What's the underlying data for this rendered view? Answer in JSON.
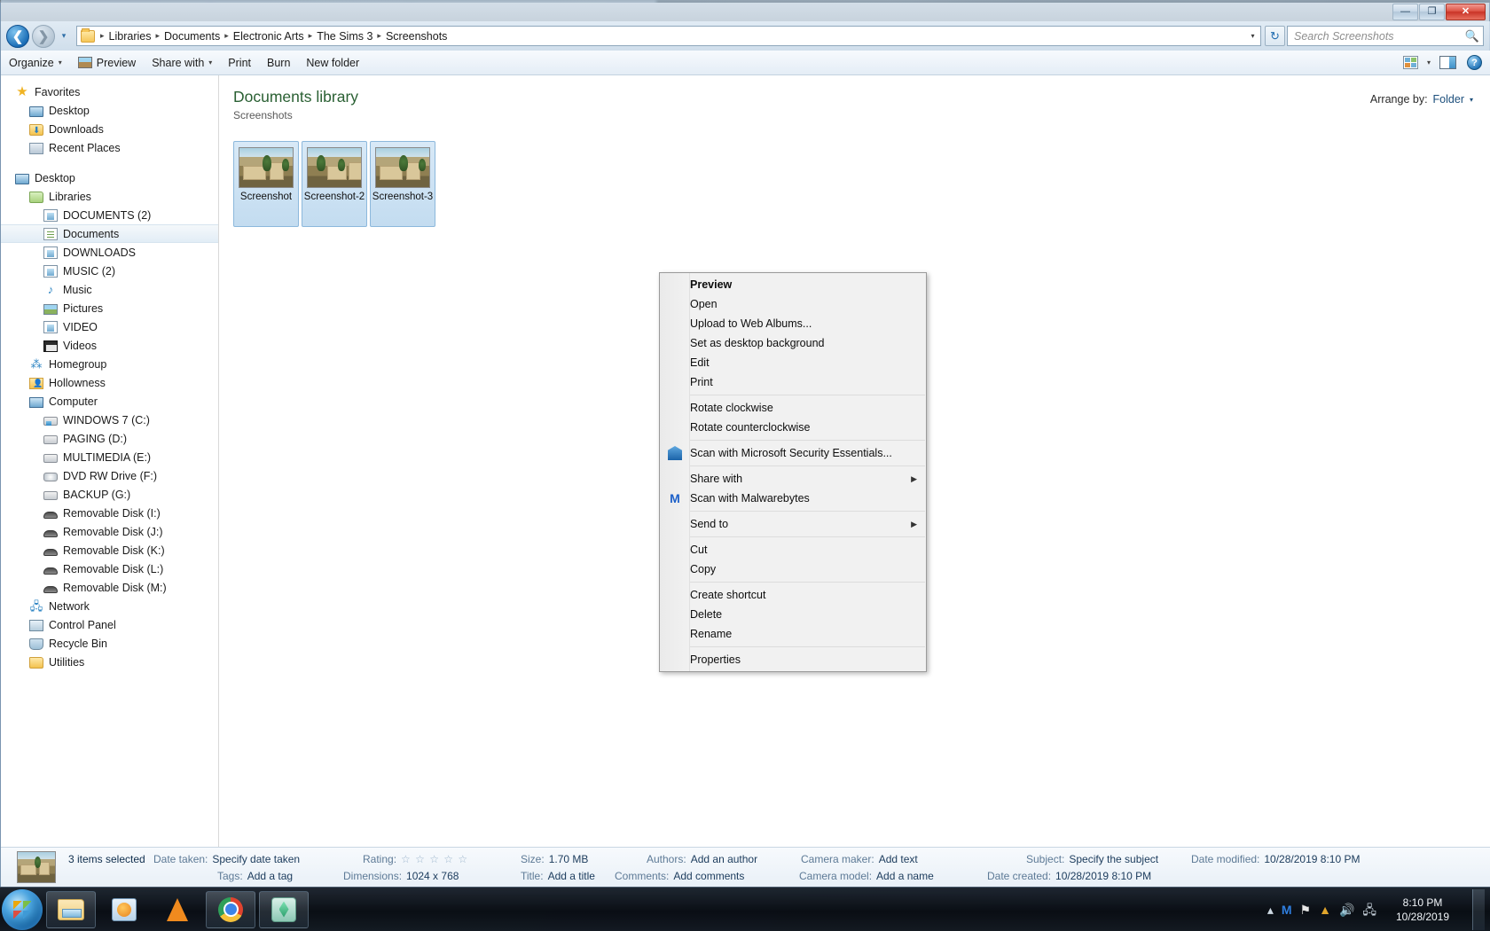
{
  "window": {
    "controls": {
      "minimize": "—",
      "maximize": "❐",
      "close": "✕"
    }
  },
  "nav": {
    "back_icon": "back-arrow",
    "forward_icon": "forward-arrow",
    "history_caret": "▾",
    "breadcrumbs": [
      "Libraries",
      "Documents",
      "Electronic Arts",
      "The Sims 3",
      "Screenshots"
    ],
    "separator": "▸",
    "address_caret": "▾",
    "refresh_label": "↻",
    "search_placeholder": "Search Screenshots",
    "search_value": "",
    "search_icon": "🔍"
  },
  "toolbar": {
    "organize": "Organize",
    "preview": "Preview",
    "share_with": "Share with",
    "print": "Print",
    "burn": "Burn",
    "new_folder": "New folder",
    "caret": "▾",
    "help": "?"
  },
  "sidebar": {
    "items": [
      {
        "label": "Favorites",
        "icon": "star-icon",
        "indent": 0,
        "selected": false
      },
      {
        "label": "Desktop",
        "icon": "monitor-icon",
        "indent": 1,
        "selected": false
      },
      {
        "label": "Downloads",
        "icon": "downloads-folder-icon",
        "indent": 1,
        "selected": false
      },
      {
        "label": "Recent Places",
        "icon": "recent-places-icon",
        "indent": 1,
        "selected": false
      },
      {
        "label": "",
        "icon": "spacer",
        "indent": 0,
        "selected": false
      },
      {
        "label": "Desktop",
        "icon": "monitor-icon",
        "indent": 0,
        "selected": false
      },
      {
        "label": "Libraries",
        "icon": "libraries-folder-icon",
        "indent": 1,
        "selected": false
      },
      {
        "label": "DOCUMENTS (2)",
        "icon": "library-icon",
        "indent": 2,
        "selected": false
      },
      {
        "label": "Documents",
        "icon": "documents-library-icon",
        "indent": 2,
        "selected": true
      },
      {
        "label": "DOWNLOADS",
        "icon": "library-icon",
        "indent": 2,
        "selected": false
      },
      {
        "label": "MUSIC (2)",
        "icon": "library-icon",
        "indent": 2,
        "selected": false
      },
      {
        "label": "Music",
        "icon": "music-note-icon",
        "indent": 2,
        "selected": false
      },
      {
        "label": "Pictures",
        "icon": "pictures-icon",
        "indent": 2,
        "selected": false
      },
      {
        "label": "VIDEO",
        "icon": "library-icon",
        "indent": 2,
        "selected": false
      },
      {
        "label": "Videos",
        "icon": "video-icon",
        "indent": 2,
        "selected": false
      },
      {
        "label": "Homegroup",
        "icon": "homegroup-icon",
        "indent": 1,
        "selected": false
      },
      {
        "label": "Hollowness",
        "icon": "user-folder-icon",
        "indent": 1,
        "selected": false
      },
      {
        "label": "Computer",
        "icon": "computer-icon",
        "indent": 1,
        "selected": false
      },
      {
        "label": "WINDOWS 7 (C:)",
        "icon": "system-drive-icon",
        "indent": 2,
        "selected": false
      },
      {
        "label": "PAGING (D:)",
        "icon": "hard-drive-icon",
        "indent": 2,
        "selected": false
      },
      {
        "label": "MULTIMEDIA (E:)",
        "icon": "hard-drive-icon",
        "indent": 2,
        "selected": false
      },
      {
        "label": "DVD RW Drive (F:)",
        "icon": "dvd-drive-icon",
        "indent": 2,
        "selected": false
      },
      {
        "label": "BACKUP (G:)",
        "icon": "hard-drive-icon",
        "indent": 2,
        "selected": false
      },
      {
        "label": "Removable Disk (I:)",
        "icon": "usb-drive-icon",
        "indent": 2,
        "selected": false
      },
      {
        "label": "Removable Disk (J:)",
        "icon": "usb-drive-icon",
        "indent": 2,
        "selected": false
      },
      {
        "label": "Removable Disk (K:)",
        "icon": "usb-drive-icon",
        "indent": 2,
        "selected": false
      },
      {
        "label": "Removable Disk (L:)",
        "icon": "usb-drive-icon",
        "indent": 2,
        "selected": false
      },
      {
        "label": "Removable Disk (M:)",
        "icon": "usb-drive-icon",
        "indent": 2,
        "selected": false
      },
      {
        "label": "Network",
        "icon": "network-icon",
        "indent": 1,
        "selected": false
      },
      {
        "label": "Control Panel",
        "icon": "control-panel-icon",
        "indent": 1,
        "selected": false
      },
      {
        "label": "Recycle Bin",
        "icon": "recycle-bin-icon",
        "indent": 1,
        "selected": false
      },
      {
        "label": "Utilities",
        "icon": "folder-icon",
        "indent": 1,
        "selected": false
      }
    ]
  },
  "content": {
    "library_title": "Documents library",
    "library_subtitle": "Screenshots",
    "arrange_label": "Arrange by:",
    "arrange_value": "Folder",
    "arrange_caret": "▾",
    "files": [
      {
        "name": "Screenshot",
        "selected": true
      },
      {
        "name": "Screenshot-2",
        "selected": true
      },
      {
        "name": "Screenshot-3",
        "selected": true
      }
    ]
  },
  "context_menu": {
    "items": [
      {
        "label": "Preview",
        "bold": true,
        "icon": null,
        "submenu": false,
        "separator_after": false
      },
      {
        "label": "Open",
        "bold": false,
        "icon": null,
        "submenu": false,
        "separator_after": false
      },
      {
        "label": "Upload to Web Albums...",
        "bold": false,
        "icon": null,
        "submenu": false,
        "separator_after": false
      },
      {
        "label": "Set as desktop background",
        "bold": false,
        "icon": null,
        "submenu": false,
        "separator_after": false
      },
      {
        "label": "Edit",
        "bold": false,
        "icon": null,
        "submenu": false,
        "separator_after": false
      },
      {
        "label": "Print",
        "bold": false,
        "icon": null,
        "submenu": false,
        "separator_after": true
      },
      {
        "label": "Rotate clockwise",
        "bold": false,
        "icon": null,
        "submenu": false,
        "separator_after": false
      },
      {
        "label": "Rotate counterclockwise",
        "bold": false,
        "icon": null,
        "submenu": false,
        "separator_after": true
      },
      {
        "label": "Scan with Microsoft Security Essentials...",
        "bold": false,
        "icon": "security-essentials-icon",
        "submenu": false,
        "separator_after": true
      },
      {
        "label": "Share with",
        "bold": false,
        "icon": null,
        "submenu": true,
        "separator_after": false
      },
      {
        "label": "Scan with Malwarebytes",
        "bold": false,
        "icon": "malwarebytes-icon",
        "submenu": false,
        "separator_after": true
      },
      {
        "label": "Send to",
        "bold": false,
        "icon": null,
        "submenu": true,
        "separator_after": true
      },
      {
        "label": "Cut",
        "bold": false,
        "icon": null,
        "submenu": false,
        "separator_after": false
      },
      {
        "label": "Copy",
        "bold": false,
        "icon": null,
        "submenu": false,
        "separator_after": true
      },
      {
        "label": "Create shortcut",
        "bold": false,
        "icon": null,
        "submenu": false,
        "separator_after": false
      },
      {
        "label": "Delete",
        "bold": false,
        "icon": null,
        "submenu": false,
        "separator_after": false
      },
      {
        "label": "Rename",
        "bold": false,
        "icon": null,
        "submenu": false,
        "separator_after": true
      },
      {
        "label": "Properties",
        "bold": false,
        "icon": null,
        "submenu": false,
        "separator_after": false
      }
    ],
    "submenu_arrow": "▶"
  },
  "details": {
    "selection": "3 items selected",
    "col1": [
      {
        "key": "Date taken:",
        "value": "Specify date taken"
      },
      {
        "key": "Tags:",
        "value": "Add a tag"
      }
    ],
    "col2": [
      {
        "key": "Rating:",
        "value": "☆ ☆ ☆ ☆ ☆"
      },
      {
        "key": "Dimensions:",
        "value": "1024 x 768"
      }
    ],
    "col3": [
      {
        "key": "Size:",
        "value": "1.70 MB"
      },
      {
        "key": "Title:",
        "value": "Add a title"
      }
    ],
    "col4": [
      {
        "key": "Authors:",
        "value": "Add an author"
      },
      {
        "key": "Comments:",
        "value": "Add comments"
      }
    ],
    "col5": [
      {
        "key": "Camera maker:",
        "value": "Add text"
      },
      {
        "key": "Camera model:",
        "value": "Add a name"
      }
    ],
    "col6": [
      {
        "key": "Subject:",
        "value": "Specify the subject"
      },
      {
        "key": "Date created:",
        "value": "10/28/2019 8:10 PM"
      }
    ],
    "col7": [
      {
        "key": "Date modified:",
        "value": "10/28/2019 8:10 PM"
      }
    ]
  },
  "taskbar": {
    "start": "start-orb",
    "buttons": [
      {
        "name": "windows-explorer",
        "active": true
      },
      {
        "name": "windows-media-player",
        "active": false
      },
      {
        "name": "vlc-media-player",
        "active": false
      },
      {
        "name": "google-chrome",
        "active": true
      },
      {
        "name": "the-sims-3",
        "active": true
      }
    ],
    "tray": {
      "show_hidden": "▴",
      "malwarebytes": "M",
      "action_center": "⚑",
      "security": "▲",
      "volume": "🔊",
      "network": "🖧"
    },
    "clock_time": "8:10 PM",
    "clock_date": "10/28/2019"
  }
}
